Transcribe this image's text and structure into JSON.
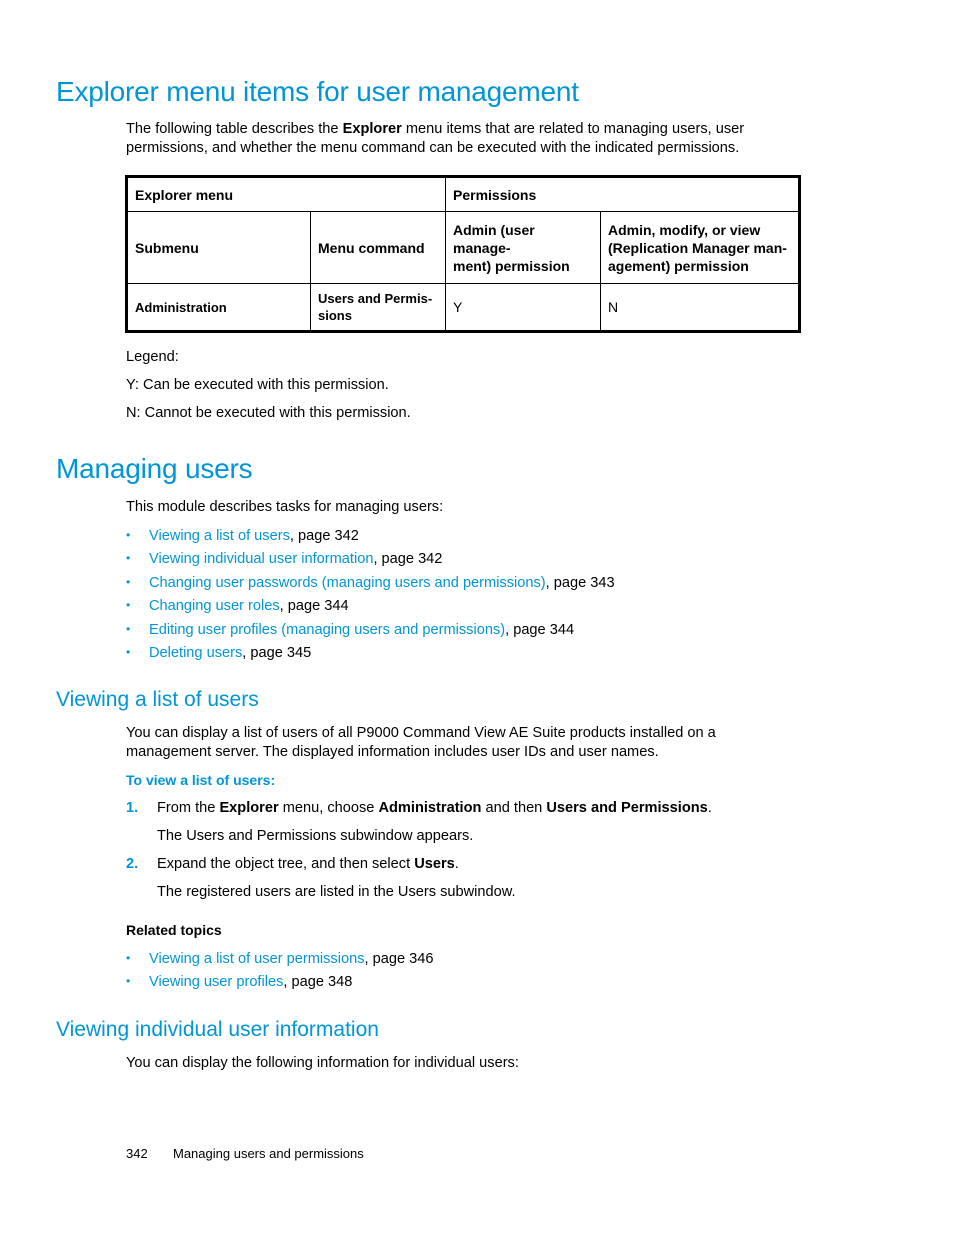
{
  "sections": {
    "explorer": {
      "title": "Explorer menu items for user management",
      "intro_before": "The following table describes the ",
      "intro_bold": "Explorer",
      "intro_after_line1": " menu items that are related to managing users, user",
      "intro_line2": "permissions, and whether the menu command can be executed with the indicated permissions.",
      "table": {
        "group_headers": [
          "Explorer menu",
          "Permissions"
        ],
        "columns": [
          "Submenu",
          "Menu command",
          "Admin (user manage-ment) permission",
          "Admin, modify, or view (Replication Manager man-agement) permission"
        ],
        "col3_line1": "Admin (user manage-",
        "col3_line2": "ment) permission",
        "col4_line1": "Admin, modify, or view",
        "col4_line2": "(Replication Manager man-",
        "col4_line3": "agement) permission",
        "rows": [
          {
            "submenu": "Administration",
            "command_line1": "Users and Permis-",
            "command_line2": "sions",
            "admin": "Y",
            "replication": "N"
          }
        ]
      },
      "legend": {
        "label": "Legend:",
        "items": [
          "Y: Can be executed with this permission.",
          "N: Cannot be executed with this permission."
        ]
      }
    },
    "managing": {
      "title": "Managing users",
      "intro": "This module describes tasks for managing users:",
      "links": [
        {
          "text": "Viewing a list of users",
          "suffix": ", page 342"
        },
        {
          "text": "Viewing individual user information",
          "suffix": ", page 342"
        },
        {
          "text": "Changing user passwords (managing users and permissions)",
          "suffix": ", page 343"
        },
        {
          "text": "Changing user roles",
          "suffix": ", page 344"
        },
        {
          "text": "Editing user profiles (managing users and permissions)",
          "suffix": ", page 344"
        },
        {
          "text": "Deleting users",
          "suffix": ", page 345"
        }
      ]
    },
    "viewing_list": {
      "title": "Viewing a list of users",
      "para_line1": "You can display a list of users of all P9000 Command View AE Suite products installed on a",
      "para_line2": "management server. The displayed information includes user IDs and user names.",
      "procedure_title": "To view a list of users:",
      "steps": [
        {
          "num": "1.",
          "t1": "From the ",
          "b1": "Explorer",
          "t2": " menu, choose ",
          "b2": "Administration",
          "t3": " and then ",
          "b3": "Users and Permissions",
          "t4": ".",
          "result": "The Users and Permissions subwindow appears."
        },
        {
          "num": "2.",
          "t1": "Expand the object tree, and then select ",
          "b1": "Users",
          "t2": ".",
          "result": "The registered users are listed in the Users subwindow."
        }
      ],
      "related_title": "Related topics",
      "related": [
        {
          "text": "Viewing a list of user permissions",
          "suffix": ", page 346"
        },
        {
          "text": "Viewing user profiles",
          "suffix": ", page 348"
        }
      ]
    },
    "viewing_individual": {
      "title": "Viewing individual user information",
      "intro": "You can display the following information for individual users:"
    }
  },
  "footer": {
    "page_number": "342",
    "chapter": "Managing users and permissions"
  },
  "colors": {
    "accent": "#0096d6",
    "text": "#000000"
  }
}
